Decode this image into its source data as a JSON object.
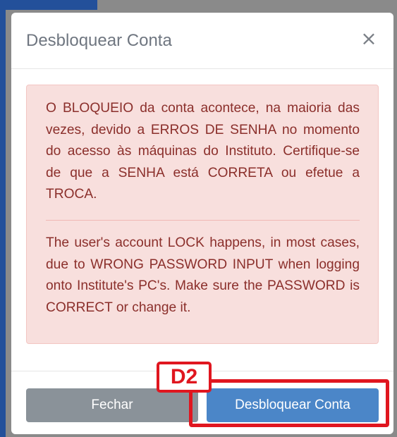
{
  "modal": {
    "title": "Desbloquear Conta",
    "close_symbol": "×",
    "close_icon": "close-icon"
  },
  "alert": {
    "pt_text": "O BLOQUEIO da conta acontece, na maioria das vezes, devido a ERROS DE SENHA no momento do acesso às máquinas do Instituto. Certifique-se de que a SENHA está CORRETA ou efetue a TROCA.",
    "en_text": "The user's account LOCK happens, in most cases, due to WRONG PASSWORD INPUT when logging onto Institute's PC's. Make sure the PASSWORD is CORRECT or change it."
  },
  "footer": {
    "close_label": "Fechar",
    "unlock_label": "Desbloquear Conta"
  },
  "annotation": {
    "label": "D2",
    "color": "#e0161f"
  },
  "colors": {
    "alert_background": "#f8dfdd",
    "alert_text": "#8b2f2b",
    "primary_button": "#4b86c8",
    "secondary_button": "#8a9299"
  }
}
